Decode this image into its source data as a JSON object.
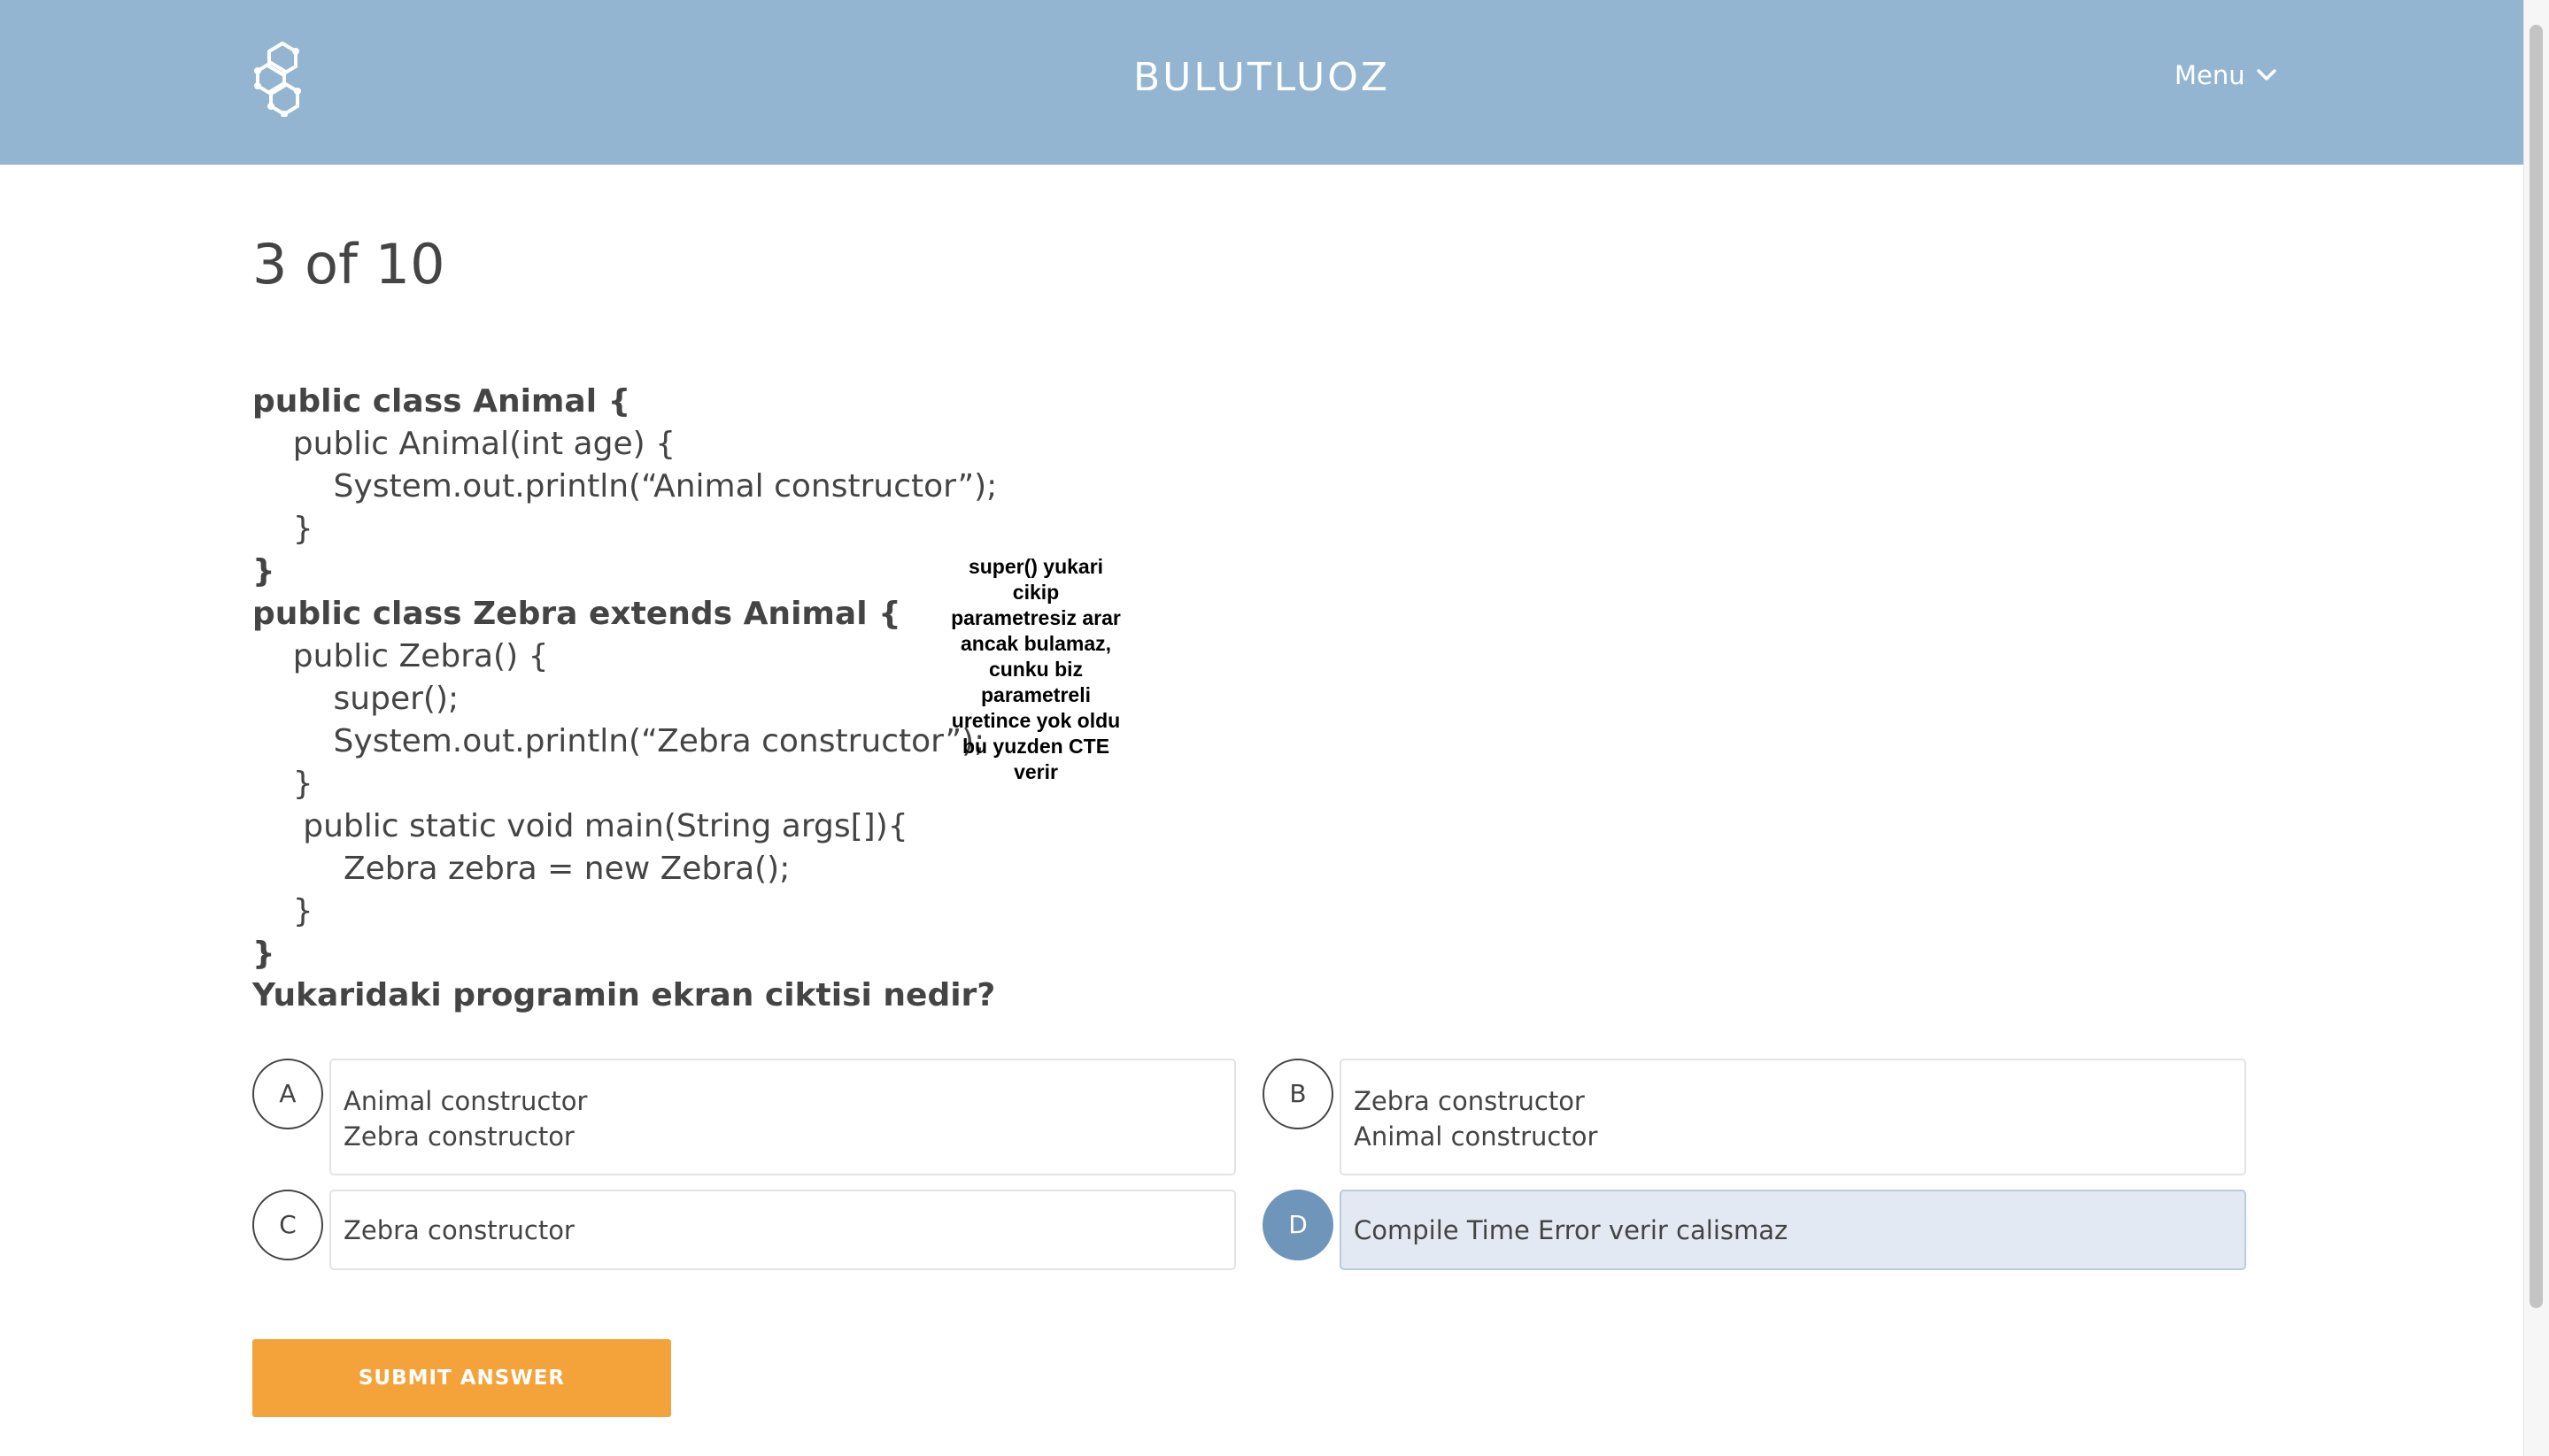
{
  "header": {
    "brand": "BULUTLUOZ",
    "menu_label": "Menu",
    "logo_icon": "hexagon-molecule-icon",
    "menu_icon": "chevron-down-icon",
    "background_color": "#93b5d1"
  },
  "quiz": {
    "progress": "3 of 10",
    "code_lines": [
      "public class Animal {",
      "    public Animal(int age) {",
      "        System.out.println(“Animal constructor”);",
      "    }",
      "}",
      "public class Zebra extends Animal {",
      "    public Zebra() {",
      "        super();",
      "        System.out.println(“Zebra constructor”);",
      "    }",
      "     public static void main(String args[]){",
      "         Zebra zebra = new Zebra();",
      "    }",
      "}"
    ],
    "note_lines": [
      "super() yukari",
      "cikip",
      "parametresiz arar",
      "ancak bulamaz,",
      "cunku biz",
      "parametreli",
      "uretince yok oldu",
      "bu yuzden CTE",
      "verir"
    ],
    "question": "Yukaridaki programin ekran ciktisi nedir?",
    "options": [
      {
        "letter": "A",
        "lines": [
          "Animal constructor",
          "Zebra constructor"
        ],
        "selected": false
      },
      {
        "letter": "B",
        "lines": [
          "Zebra constructor",
          "Animal constructor"
        ],
        "selected": false
      },
      {
        "letter": "C",
        "lines": [
          "Zebra constructor"
        ],
        "selected": false
      },
      {
        "letter": "D",
        "lines": [
          "Compile Time Error verir calismaz"
        ],
        "selected": true
      }
    ],
    "submit_label": "SUBMIT ANSWER",
    "submit_color": "#f4a33a",
    "selected_color": "#6f95bb"
  }
}
